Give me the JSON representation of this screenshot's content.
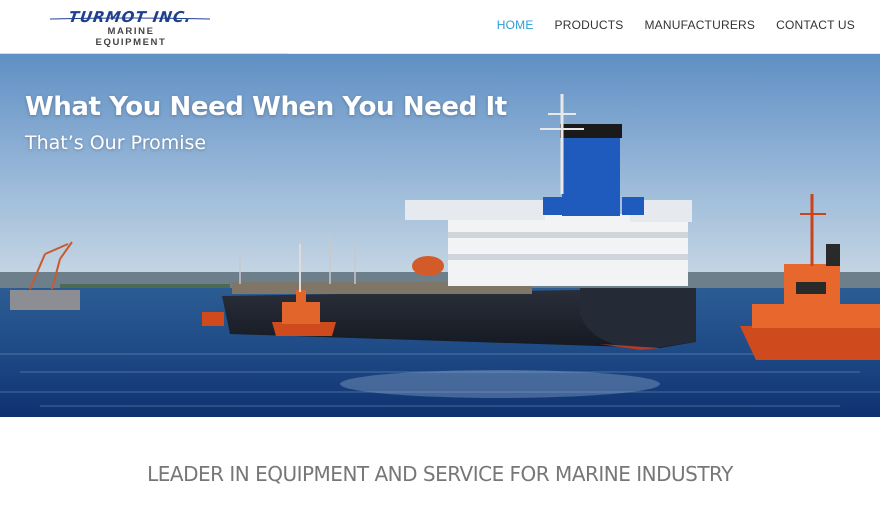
{
  "brand": {
    "name": "TURMOT INC.",
    "tagline": "MARINE EQUIPMENT",
    "color": "#1f3f8f"
  },
  "nav": {
    "items": [
      {
        "label": "HOME",
        "active": true
      },
      {
        "label": "PRODUCTS",
        "active": false
      },
      {
        "label": "MANUFACTURERS",
        "active": false
      },
      {
        "label": "CONTACT US",
        "active": false
      }
    ],
    "active_color": "#2a9fd6"
  },
  "hero": {
    "title": "What You Need When You Need It",
    "subtitle": "That’s Our Promise",
    "image_icon": "tanker-ship-photo"
  },
  "section": {
    "heading": "LEADER IN EQUIPMENT AND SERVICE FOR MARINE INDUSTRY"
  }
}
